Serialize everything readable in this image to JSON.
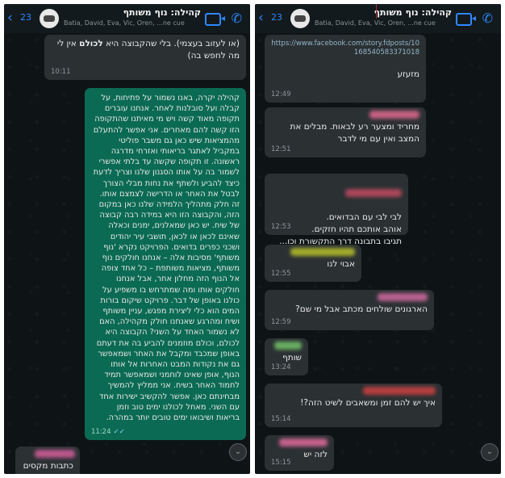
{
  "colors": {
    "accent": "#2f88ff",
    "incoming_bubble": "#2b3033",
    "outgoing_bubble": "#0b6a53",
    "background": "#0e1416",
    "sender_tags": [
      "#d35f9b",
      "#e0698f",
      "#c04a60",
      "#b8c22a",
      "#d06aa0",
      "#74c36a",
      "#d04040",
      "#e06a9a",
      "#c05088"
    ]
  },
  "left": {
    "header": {
      "back_icon": "‹",
      "back_count": "23",
      "title": "קהילה: נוף משותף",
      "members": "Batia, David, Eva, Vic, Oren, ...ne cue"
    },
    "messages": [
      {
        "text_a": "(או לעזוב בעצמי). בלי שהקבוצה היא ",
        "text_b": "לכולם",
        "text_c": " אין לי מה לחפש בה)",
        "time": "10:11"
      },
      {
        "text": "קהילה יקרה, באנו נשמור על פתיחות, על קבלה ועל סובלנות לאחר. אנחנו עוברים תקופה מאוד קשה ויש מי מאיתנו שהתקופה הזו קשה להם מאחרים. אני אפשר להתעלם מהמציאות שיש כאן גם משבר פוליטי במקביל לאתגר בריאותי ואזרחי מדרגה ראשונה. זו תקופה שקשה עד בלתי אפשרי לשמור בה על אותו הסגנון שלנו וצריך לדעת כיצד להביע ולשתף את נחות מבלי הצורך לבטל את האחר או הדרישה לצמצם אותו. זה חלק מתהליך הלמידה שלנו כאן במקום הזה, והקבוצה הזו היא במידה רבה קבוצה של שיח. יש כאן שמאלנים, ימנים וכאלה שאינם לכאן או לכאן, תושבי עיר יהודים ושכני כפרים בדואים. הפרויקט נקרא 'נוף משותף' מסיבות אלה – אנחנו חולקים נוף משותף, מציאות משותפת – כל אחד צופה אל הנוף הזה מחלון אחר, אבל אנחנו חולקים אותו ומה שמתרחש בו משפיע על כולנו באופן של דבר. פרויקט שיקום בורות המים הוא כלי ליצירת מפגש, עניין משותף ושיח ומהרגע שאנחנו חולק מקהילה, האם לא נשמור האחד על השני? הקבוצה היא לכולם, וכולם מוזמנים להביע בה את דעתם באופן שמכבד ומקבל את האחר ושמאפשר גם את נקודות המבט האחרות אל אותו הנוף, אופן שאינו לוחמני ושמאפשר תמיד לחמוד האחר בשיח. אני ממליץ להמשיך מבחינתם כאן. אפשר להקשיב ישירות אחד עם השני. מאחל לכולנו ימים טוב וזמן בריאות ושיבואו ימים טובים יותר במהרה.",
        "time": "11:24",
        "ticks": "✓✓"
      },
      {
        "text": "כתבות מקסים",
        "time": ""
      }
    ],
    "scroll_icon": "⌄"
  },
  "right": {
    "header": {
      "back_icon": "‹",
      "back_count": "23",
      "title": "קהילה: נוף משותף",
      "members": "Batia, David, Eva, Vic, Oren, ...ne cue"
    },
    "messages": [
      {
        "link": "https://www.facebook.com/story.fdposts/10168540583371018",
        "text": "מזעזע",
        "time": "12:49"
      },
      {
        "text": "מחריד ומצער רע לבאות. מבלים את המצב ואין עם מי לדבר",
        "time": "12:51"
      },
      {
        "text": "לבי לבי עם הבדואים.\nאוהב אותכם תהיו חזקים.\nתגיבו בתבונה דרך התקשורת וכו...",
        "time": "12:53"
      },
      {
        "text": "אבוי לנו",
        "time": "12:55"
      },
      {
        "text": "הארגונים שולחים מכתב אבל מי שם?",
        "time": "12:59"
      },
      {
        "text": "שותף",
        "time": "13:24"
      },
      {
        "text": "איך יש להם זמן ומשאבים לשיט הזה?!",
        "time": "15:14"
      },
      {
        "text": "לזה יש",
        "time": "15:15"
      }
    ],
    "scroll_icon": "⌄"
  }
}
